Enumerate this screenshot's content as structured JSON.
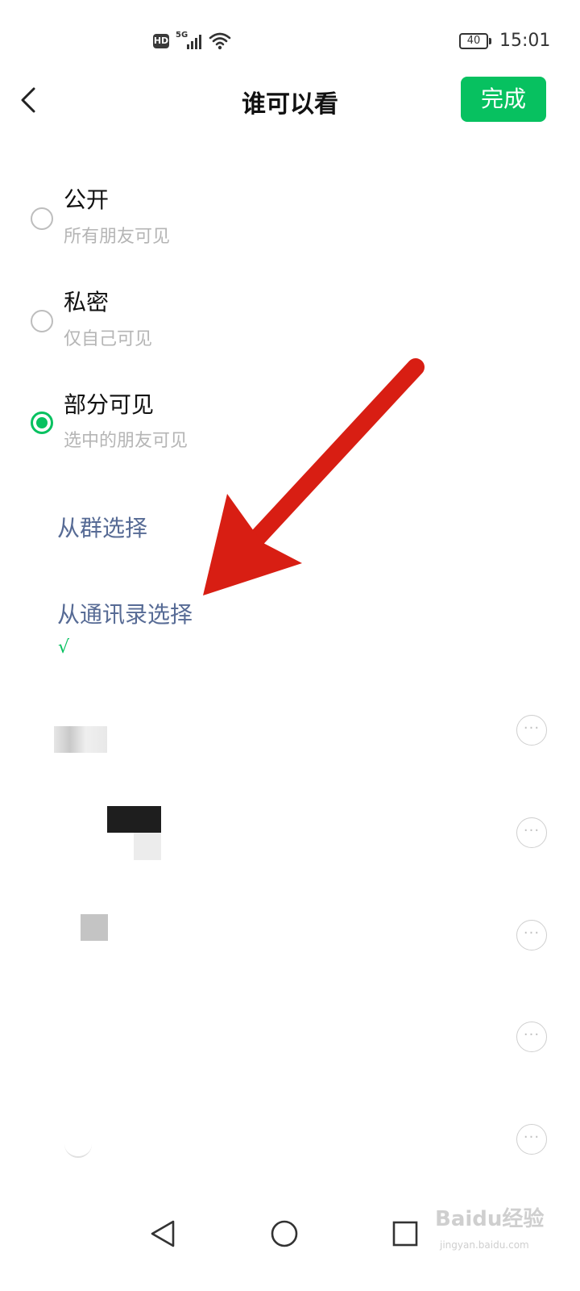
{
  "status_bar": {
    "hd": "HD",
    "network": "5G",
    "battery": "40",
    "time": "15:01"
  },
  "header": {
    "title": "谁可以看",
    "done_label": "完成"
  },
  "options": [
    {
      "label": "公开",
      "desc": "所有朋友可见",
      "selected": false
    },
    {
      "label": "私密",
      "desc": "仅自己可见",
      "selected": false
    },
    {
      "label": "部分可见",
      "desc": "选中的朋友可见",
      "selected": true
    }
  ],
  "links": {
    "from_group": "从群选择",
    "from_contacts": "从通讯录选择",
    "check_mark": "√"
  },
  "contacts": [
    {
      "more": "···"
    },
    {
      "more": "···"
    },
    {
      "more": "···"
    },
    {
      "more": "···"
    },
    {
      "more": "···"
    }
  ],
  "watermark": {
    "main": "Baidu经验",
    "sub": "jingyan.baidu.com"
  },
  "colors": {
    "accent": "#07c160",
    "link": "#576b95",
    "arrow": "#d81e13"
  },
  "icons": {
    "back": "chevron-left-icon",
    "nav_back": "triangle-back-icon",
    "nav_home": "circle-home-icon",
    "nav_recent": "square-recent-icon"
  }
}
